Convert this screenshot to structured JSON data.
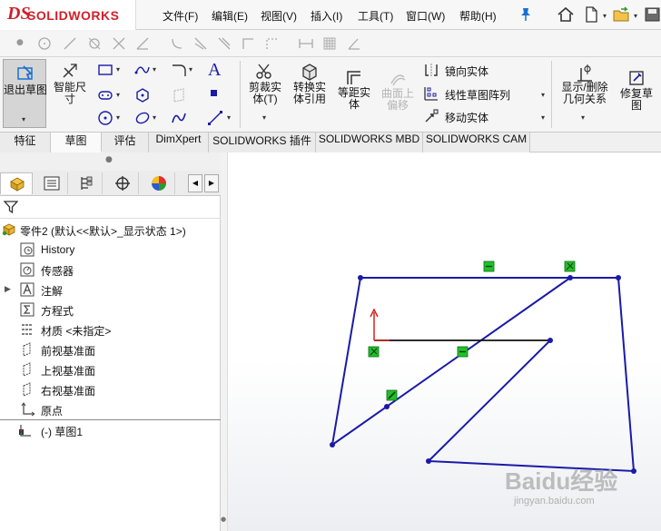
{
  "app": {
    "brand_ds": "DS",
    "brand_name": "SOLIDWORKS"
  },
  "menu": [
    {
      "label": "文件(F)"
    },
    {
      "label": "编辑(E)"
    },
    {
      "label": "视图(V)"
    },
    {
      "label": "插入(I)"
    },
    {
      "label": "工具(T)"
    },
    {
      "label": "窗口(W)"
    },
    {
      "label": "帮助(H)"
    }
  ],
  "commands": {
    "exit_sketch": "退出草图",
    "smart_dim_line1": "智能尺",
    "smart_dim_line2": "寸",
    "trim_line1": "剪裁实",
    "trim_line2": "体(T)",
    "convert_line1": "转换实",
    "convert_line2": "体引用",
    "offset_line1": "等距实",
    "offset_line2": "体",
    "offset_surface_line1": "曲面上",
    "offset_surface_line2": "偏移",
    "mirror": "镜向实体",
    "linear_pattern": "线性草图阵列",
    "move": "移动实体",
    "display_relations_line1": "显示/删除",
    "display_relations_line2": "几何关系",
    "repair_line1": "修复草",
    "repair_line2": "图"
  },
  "tabs": [
    {
      "label": "特征"
    },
    {
      "label": "草图"
    },
    {
      "label": "评估"
    },
    {
      "label": "DimXpert"
    },
    {
      "label": "SOLIDWORKS 插件"
    },
    {
      "label": "SOLIDWORKS MBD"
    },
    {
      "label": "SOLIDWORKS CAM"
    }
  ],
  "tree": {
    "root": "零件2  (默认<<默认>_显示状态 1>)",
    "items": [
      {
        "label": "History"
      },
      {
        "label": "传感器"
      },
      {
        "label": "注解"
      },
      {
        "label": "方程式"
      },
      {
        "label": "材质 <未指定>"
      },
      {
        "label": "前视基准面"
      },
      {
        "label": "上视基准面"
      },
      {
        "label": "右视基准面"
      },
      {
        "label": "原点"
      },
      {
        "label": "(-) 草图1"
      }
    ]
  },
  "colors": {
    "sketch_line": "#1a1aa8",
    "relation_marker": "#22c02a",
    "origin_red": "#d42020",
    "brand_red": "#d0202a"
  },
  "watermark": {
    "main": "Baidu经验",
    "sub": "jingyan.baidu.com"
  }
}
